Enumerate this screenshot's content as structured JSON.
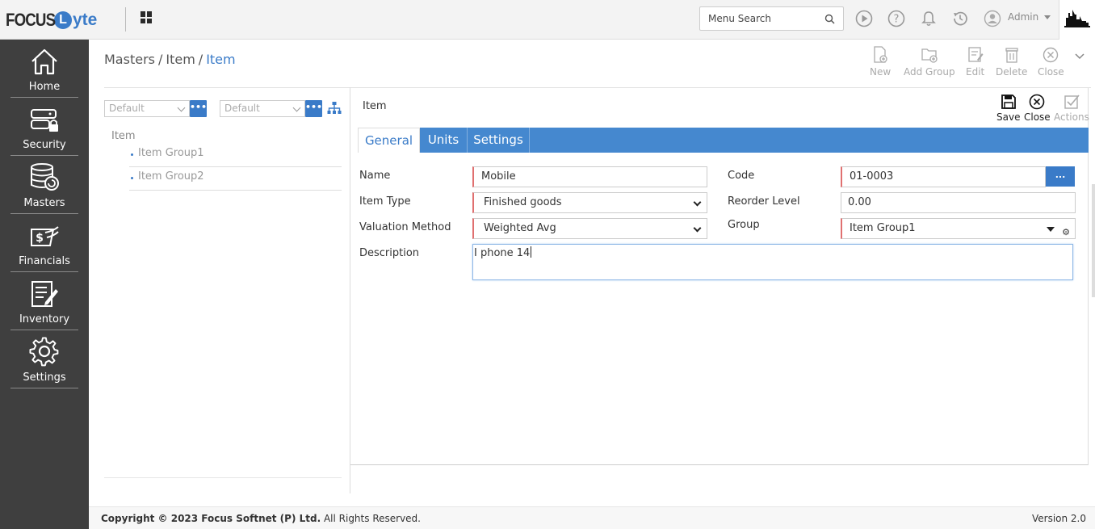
{
  "app": {
    "logo_focus": "FOCUS",
    "logo_l": "L",
    "logo_yte": "yte",
    "brand_color": "#3a7bc8"
  },
  "topbar": {
    "search_placeholder": "Menu Search",
    "user": "Admin",
    "icons": [
      "apps-grid-icon",
      "search-icon",
      "play-icon",
      "help-icon",
      "bell-icon",
      "history-icon",
      "user-icon",
      "company-logo"
    ]
  },
  "sidebar": {
    "items": [
      {
        "label": "Home",
        "icon": "home-icon"
      },
      {
        "label": "Security",
        "icon": "security-icon"
      },
      {
        "label": "Masters",
        "icon": "masters-icon"
      },
      {
        "label": "Financials",
        "icon": "financials-icon"
      },
      {
        "label": "Inventory",
        "icon": "inventory-icon"
      },
      {
        "label": "Settings",
        "icon": "settings-icon"
      }
    ]
  },
  "breadcrumb": {
    "part1": "Masters",
    "part2": "Item",
    "current": "Item",
    "sep": "/"
  },
  "toolbar": {
    "new": "New",
    "add_group": "Add Group",
    "edit": "Edit",
    "delete": "Delete",
    "close": "Close"
  },
  "tree": {
    "select1": "Default",
    "select2": "Default",
    "more": "•••",
    "root": "Item",
    "items": [
      "Item Group1",
      "Item Group2"
    ]
  },
  "form": {
    "title": "Item",
    "actions": {
      "save": "Save",
      "close": "Close",
      "actions": "Actions"
    },
    "tabs": [
      "General",
      "Units",
      "Settings"
    ],
    "fields": {
      "name_label": "Name",
      "name_value": "Mobile",
      "item_type_label": "Item Type",
      "item_type_value": "Finished goods",
      "valuation_label": "Valuation Method",
      "valuation_value": "Weighted Avg",
      "description_label": "Description",
      "description_value": "I phone 14",
      "code_label": "Code",
      "code_value": "01-0003",
      "code_btn": "...",
      "reorder_label": "Reorder Level",
      "reorder_value": "0.00",
      "group_label": "Group",
      "group_value": "Item Group1"
    }
  },
  "footer": {
    "copyright": "Copyright © 2023 Focus Softnet (P) Ltd.",
    "rights": " All Rights Reserved.",
    "version": "Version 2.0"
  }
}
